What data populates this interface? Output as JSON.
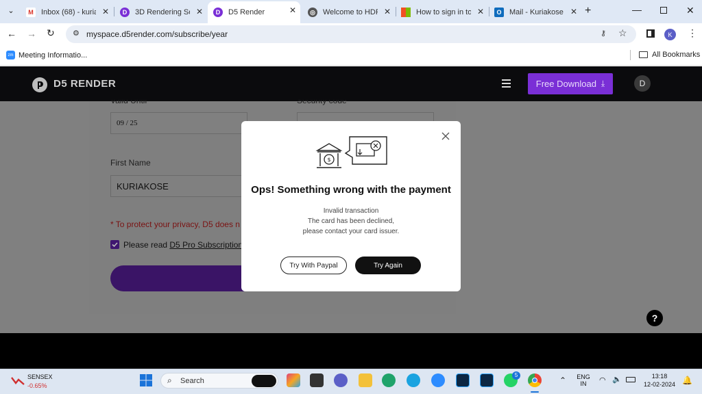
{
  "browser": {
    "tabs": [
      {
        "label": "Inbox (68) - kurian",
        "icon": "gmail-icon",
        "active": false
      },
      {
        "label": "3D Rendering Soft",
        "icon": "d5-icon",
        "active": false
      },
      {
        "label": "D5 Render",
        "icon": "d5-icon",
        "active": true
      },
      {
        "label": "Welcome to HDFC",
        "icon": "globe-icon",
        "active": false
      },
      {
        "label": "How to sign in to",
        "icon": "microsoft-icon",
        "active": false
      },
      {
        "label": "Mail - Kuriakose P",
        "icon": "outlook-icon",
        "active": false
      }
    ],
    "url": "myspace.d5render.com/subscribe/year",
    "profile_initial": "K",
    "bookmark": "Meeting Informatio...",
    "all_bookmarks": "All Bookmarks"
  },
  "site": {
    "brand": "D5 RENDER",
    "free_download": "Free Download",
    "avatar_initial": "D",
    "form": {
      "valid_until_label": "Valid Until",
      "valid_until_value": "09 / 25",
      "security_code_label": "Security code",
      "first_name_label": "First Name",
      "first_name_value": "KURIAKOSE",
      "privacy_note": "* To protect your privacy, D5 does n",
      "agree_prefix": "Please read ",
      "agree_link": "D5 Pro Subscription"
    },
    "help": "?"
  },
  "modal": {
    "title": "Ops! Something wrong with the payment",
    "line1": "Invalid transaction",
    "line2": "The card has been declined,",
    "line3": "please contact your card issuer.",
    "paypal_button": "Try With Paypal",
    "retry_button": "Try Again"
  },
  "taskbar": {
    "ticker_name": "SENSEX",
    "ticker_change": "-0.65%",
    "search_placeholder": "Search",
    "lang_top": "ENG",
    "lang_bottom": "IN",
    "time": "13:18",
    "date": "12-02-2024",
    "whatsapp_badge": "5"
  },
  "colors": {
    "brand_purple": "#7a2fd6",
    "modal_dark_button": "#111111",
    "ticker_red": "#d03030"
  }
}
